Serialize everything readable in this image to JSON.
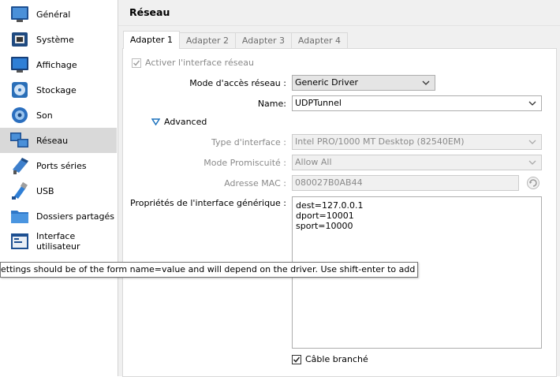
{
  "sidebar": {
    "items": [
      {
        "label": "Général",
        "icon": "general-icon"
      },
      {
        "label": "Système",
        "icon": "system-icon"
      },
      {
        "label": "Affichage",
        "icon": "display-icon"
      },
      {
        "label": "Stockage",
        "icon": "storage-icon"
      },
      {
        "label": "Son",
        "icon": "audio-icon"
      },
      {
        "label": "Réseau",
        "icon": "network-icon",
        "selected": true
      },
      {
        "label": "Ports séries",
        "icon": "serial-ports-icon"
      },
      {
        "label": "USB",
        "icon": "usb-icon"
      },
      {
        "label": "Dossiers partagés",
        "icon": "shared-folders-icon"
      },
      {
        "label": "Interface utilisateur",
        "icon": "user-interface-icon"
      }
    ]
  },
  "header": {
    "title": "Réseau"
  },
  "tabs": [
    "Adapter 1",
    "Adapter 2",
    "Adapter 3",
    "Adapter 4"
  ],
  "active_tab": "Adapter 1",
  "form": {
    "enable_label": "Activer l'interface réseau",
    "enable_checked": true,
    "attached_label": "Mode d'accès réseau :",
    "attached_value": "Generic Driver",
    "name_label": "Name:",
    "name_value": "UDPTunnel",
    "advanced_label": "Advanced",
    "adapter_type_label": "Type d'interface :",
    "adapter_type_value": "Intel PRO/1000 MT Desktop (82540EM)",
    "promisc_label": "Mode Promiscuité :",
    "promisc_value": "Allow All",
    "mac_label": "Adresse MAC :",
    "mac_value": "080027B0AB44",
    "props_label": "Propriétés de l'interface générique :",
    "props_lines": [
      "dest=127.0.0.1",
      "dport=10001",
      "sport=10000"
    ],
    "cable_label": "Câble branché",
    "cable_checked": true
  },
  "tooltip": "ettings should be of the form name=value and will depend on the driver. Use shift-enter to add a new entry.",
  "colors": {
    "selected_bg": "#d9d9d9",
    "accent": "#1e73be",
    "window_bg": "#f0f0f0"
  }
}
